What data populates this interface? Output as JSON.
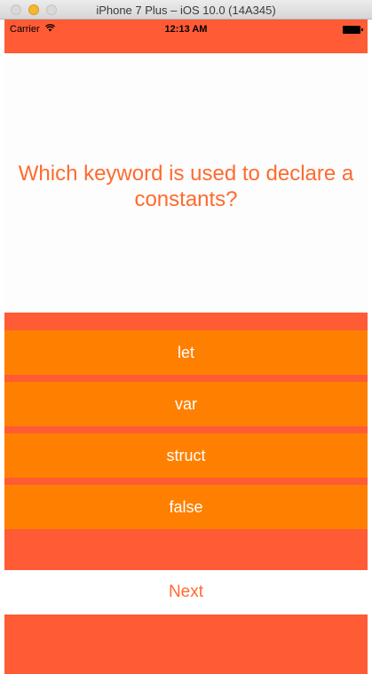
{
  "window": {
    "title": "iPhone 7 Plus – iOS 10.0 (14A345)"
  },
  "status_bar": {
    "carrier": "Carrier",
    "wifi_icon": "wifi-icon",
    "time": "12:13 AM",
    "battery_icon": "battery-icon"
  },
  "quiz": {
    "question": "Which keyword is used to declare a constants?",
    "answers": [
      "let",
      "var",
      "struct",
      "false"
    ],
    "next_label": "Next"
  },
  "colors": {
    "background": "#ff5b35",
    "question_bg": "#fdfdfd",
    "question_text": "#ff6a2f",
    "answer_bg": "#ff8000",
    "answer_text": "#ffffff",
    "next_bg": "#ffffff",
    "next_text": "#ff6a2f"
  }
}
